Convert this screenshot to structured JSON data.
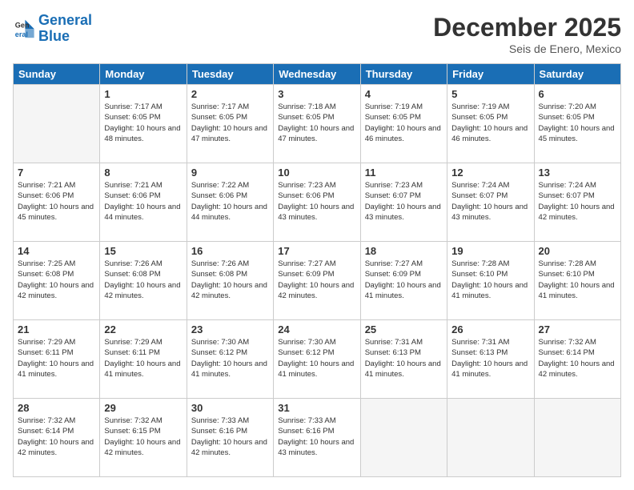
{
  "logo": {
    "line1": "General",
    "line2": "Blue"
  },
  "title": "December 2025",
  "location": "Seis de Enero, Mexico",
  "days_of_week": [
    "Sunday",
    "Monday",
    "Tuesday",
    "Wednesday",
    "Thursday",
    "Friday",
    "Saturday"
  ],
  "weeks": [
    [
      {
        "day": "",
        "empty": true
      },
      {
        "day": "1",
        "sunrise": "7:17 AM",
        "sunset": "6:05 PM",
        "daylight": "10 hours and 48 minutes."
      },
      {
        "day": "2",
        "sunrise": "7:17 AM",
        "sunset": "6:05 PM",
        "daylight": "10 hours and 47 minutes."
      },
      {
        "day": "3",
        "sunrise": "7:18 AM",
        "sunset": "6:05 PM",
        "daylight": "10 hours and 47 minutes."
      },
      {
        "day": "4",
        "sunrise": "7:19 AM",
        "sunset": "6:05 PM",
        "daylight": "10 hours and 46 minutes."
      },
      {
        "day": "5",
        "sunrise": "7:19 AM",
        "sunset": "6:05 PM",
        "daylight": "10 hours and 46 minutes."
      },
      {
        "day": "6",
        "sunrise": "7:20 AM",
        "sunset": "6:05 PM",
        "daylight": "10 hours and 45 minutes."
      }
    ],
    [
      {
        "day": "7",
        "sunrise": "7:21 AM",
        "sunset": "6:06 PM",
        "daylight": "10 hours and 45 minutes."
      },
      {
        "day": "8",
        "sunrise": "7:21 AM",
        "sunset": "6:06 PM",
        "daylight": "10 hours and 44 minutes."
      },
      {
        "day": "9",
        "sunrise": "7:22 AM",
        "sunset": "6:06 PM",
        "daylight": "10 hours and 44 minutes."
      },
      {
        "day": "10",
        "sunrise": "7:23 AM",
        "sunset": "6:06 PM",
        "daylight": "10 hours and 43 minutes."
      },
      {
        "day": "11",
        "sunrise": "7:23 AM",
        "sunset": "6:07 PM",
        "daylight": "10 hours and 43 minutes."
      },
      {
        "day": "12",
        "sunrise": "7:24 AM",
        "sunset": "6:07 PM",
        "daylight": "10 hours and 43 minutes."
      },
      {
        "day": "13",
        "sunrise": "7:24 AM",
        "sunset": "6:07 PM",
        "daylight": "10 hours and 42 minutes."
      }
    ],
    [
      {
        "day": "14",
        "sunrise": "7:25 AM",
        "sunset": "6:08 PM",
        "daylight": "10 hours and 42 minutes."
      },
      {
        "day": "15",
        "sunrise": "7:26 AM",
        "sunset": "6:08 PM",
        "daylight": "10 hours and 42 minutes."
      },
      {
        "day": "16",
        "sunrise": "7:26 AM",
        "sunset": "6:08 PM",
        "daylight": "10 hours and 42 minutes."
      },
      {
        "day": "17",
        "sunrise": "7:27 AM",
        "sunset": "6:09 PM",
        "daylight": "10 hours and 42 minutes."
      },
      {
        "day": "18",
        "sunrise": "7:27 AM",
        "sunset": "6:09 PM",
        "daylight": "10 hours and 41 minutes."
      },
      {
        "day": "19",
        "sunrise": "7:28 AM",
        "sunset": "6:10 PM",
        "daylight": "10 hours and 41 minutes."
      },
      {
        "day": "20",
        "sunrise": "7:28 AM",
        "sunset": "6:10 PM",
        "daylight": "10 hours and 41 minutes."
      }
    ],
    [
      {
        "day": "21",
        "sunrise": "7:29 AM",
        "sunset": "6:11 PM",
        "daylight": "10 hours and 41 minutes."
      },
      {
        "day": "22",
        "sunrise": "7:29 AM",
        "sunset": "6:11 PM",
        "daylight": "10 hours and 41 minutes."
      },
      {
        "day": "23",
        "sunrise": "7:30 AM",
        "sunset": "6:12 PM",
        "daylight": "10 hours and 41 minutes."
      },
      {
        "day": "24",
        "sunrise": "7:30 AM",
        "sunset": "6:12 PM",
        "daylight": "10 hours and 41 minutes."
      },
      {
        "day": "25",
        "sunrise": "7:31 AM",
        "sunset": "6:13 PM",
        "daylight": "10 hours and 41 minutes."
      },
      {
        "day": "26",
        "sunrise": "7:31 AM",
        "sunset": "6:13 PM",
        "daylight": "10 hours and 41 minutes."
      },
      {
        "day": "27",
        "sunrise": "7:32 AM",
        "sunset": "6:14 PM",
        "daylight": "10 hours and 42 minutes."
      }
    ],
    [
      {
        "day": "28",
        "sunrise": "7:32 AM",
        "sunset": "6:14 PM",
        "daylight": "10 hours and 42 minutes."
      },
      {
        "day": "29",
        "sunrise": "7:32 AM",
        "sunset": "6:15 PM",
        "daylight": "10 hours and 42 minutes."
      },
      {
        "day": "30",
        "sunrise": "7:33 AM",
        "sunset": "6:16 PM",
        "daylight": "10 hours and 42 minutes."
      },
      {
        "day": "31",
        "sunrise": "7:33 AM",
        "sunset": "6:16 PM",
        "daylight": "10 hours and 43 minutes."
      },
      {
        "day": "",
        "empty": true
      },
      {
        "day": "",
        "empty": true
      },
      {
        "day": "",
        "empty": true
      }
    ]
  ]
}
